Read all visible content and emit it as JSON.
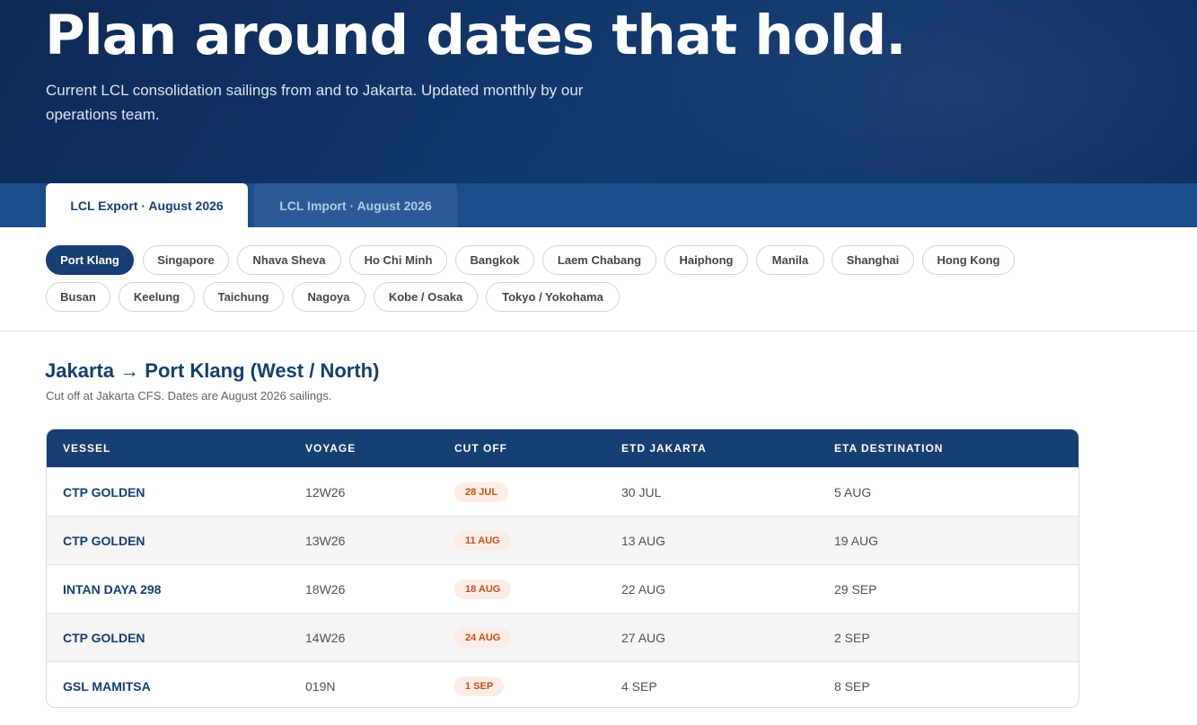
{
  "hero": {
    "title": "Plan around dates that hold.",
    "subtitle": "Current LCL consolidation sailings from and to Jakarta. Updated monthly by our operations team."
  },
  "tabs": [
    {
      "label": "LCL Export · August 2026",
      "active": true
    },
    {
      "label": "LCL Import · August 2026",
      "active": false
    }
  ],
  "ports": [
    "Port Klang",
    "Singapore",
    "Nhava Sheva",
    "Ho Chi Minh",
    "Bangkok",
    "Laem Chabang",
    "Haiphong",
    "Manila",
    "Shanghai",
    "Hong Kong",
    "Busan",
    "Keelung",
    "Taichung",
    "Nagoya",
    "Kobe / Osaka",
    "Tokyo / Yokohama"
  ],
  "active_port": "Port Klang",
  "section": {
    "title": "Jakarta → Port Klang (West / North)",
    "subtitle": "Cut off at Jakarta CFS. Dates are August 2026 sailings."
  },
  "table": {
    "headers": [
      "VESSEL",
      "VOYAGE",
      "CUT OFF",
      "ETD JAKARTA",
      "ETA DESTINATION"
    ],
    "rows": [
      {
        "vessel": "CTP GOLDEN",
        "voyage": "12W26",
        "cutoff": "28 JUL",
        "etd": "30 JUL",
        "eta": "5 AUG"
      },
      {
        "vessel": "CTP GOLDEN",
        "voyage": "13W26",
        "cutoff": "11 AUG",
        "etd": "13 AUG",
        "eta": "19 AUG"
      },
      {
        "vessel": "INTAN DAYA 298",
        "voyage": "18W26",
        "cutoff": "18 AUG",
        "etd": "22 AUG",
        "eta": "29 SEP"
      },
      {
        "vessel": "CTP GOLDEN",
        "voyage": "14W26",
        "cutoff": "24 AUG",
        "etd": "27 AUG",
        "eta": "2 SEP"
      },
      {
        "vessel": "GSL MAMITSA",
        "voyage": "019N",
        "cutoff": "1 SEP",
        "etd": "4 SEP",
        "eta": "8 SEP"
      }
    ]
  },
  "colors": {
    "navy": "#163f73",
    "tabbar": "#1b4c8c",
    "badge_bg": "#fdece3",
    "badge_text": "#c0521c"
  }
}
